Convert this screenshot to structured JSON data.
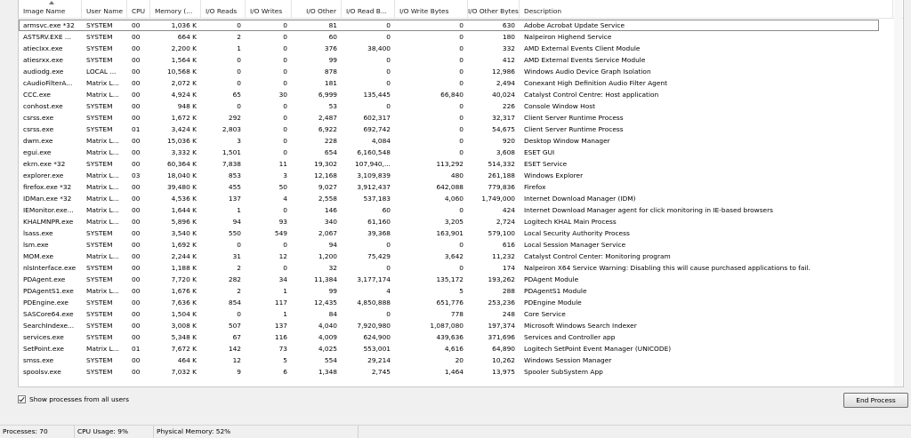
{
  "columns": [
    {
      "label": "Image Name",
      "align": "left"
    },
    {
      "label": "User Name",
      "align": "left"
    },
    {
      "label": "CPU",
      "align": "left"
    },
    {
      "label": "Memory (...",
      "align": "left"
    },
    {
      "label": "I/O Reads",
      "align": "left"
    },
    {
      "label": "I/O Writes",
      "align": "left"
    },
    {
      "label": "I/O Other",
      "align": "right"
    },
    {
      "label": "I/O Read B...",
      "align": "left"
    },
    {
      "label": "I/O Write Bytes",
      "align": "left"
    },
    {
      "label": "I/O Other Bytes",
      "align": "right"
    },
    {
      "label": "Description",
      "align": "left"
    }
  ],
  "rows": [
    [
      "armsvc.exe *32",
      "SYSTEM",
      "00",
      "1,036 K",
      "0",
      "0",
      "81",
      "0",
      "0",
      "630",
      "Adobe Acrobat Update Service"
    ],
    [
      "ASTSRV.EXE ...",
      "SYSTEM",
      "00",
      "664 K",
      "2",
      "0",
      "60",
      "0",
      "0",
      "180",
      "Nalpeiron Highend Service"
    ],
    [
      "atiecIxx.exe",
      "SYSTEM",
      "00",
      "2,200 K",
      "1",
      "0",
      "376",
      "38,400",
      "0",
      "332",
      "AMD External Events Client Module"
    ],
    [
      "atiesrxx.exe",
      "SYSTEM",
      "00",
      "1,564 K",
      "0",
      "0",
      "99",
      "0",
      "0",
      "412",
      "AMD External Events Service Module"
    ],
    [
      "audiodg.exe",
      "LOCAL ...",
      "00",
      "10,568 K",
      "0",
      "0",
      "878",
      "0",
      "0",
      "12,986",
      "Windows Audio Device Graph Isolation"
    ],
    [
      "cAudioFilterA...",
      "Matrix L...",
      "00",
      "2,072 K",
      "0",
      "0",
      "181",
      "0",
      "0",
      "2,494",
      "Conexant High Definition Audio Filter Agent"
    ],
    [
      "CCC.exe",
      "Matrix L...",
      "00",
      "4,924 K",
      "65",
      "30",
      "6,999",
      "135,445",
      "66,840",
      "40,024",
      "Catalyst Control Centre: Host application"
    ],
    [
      "conhost.exe",
      "SYSTEM",
      "00",
      "948 K",
      "0",
      "0",
      "53",
      "0",
      "0",
      "226",
      "Console Window Host"
    ],
    [
      "csrss.exe",
      "SYSTEM",
      "00",
      "1,672 K",
      "292",
      "0",
      "2,487",
      "602,317",
      "0",
      "32,317",
      "Client Server Runtime Process"
    ],
    [
      "csrss.exe",
      "SYSTEM",
      "01",
      "3,424 K",
      "2,803",
      "0",
      "6,922",
      "692,742",
      "0",
      "54,675",
      "Client Server Runtime Process"
    ],
    [
      "dwm.exe",
      "Matrix L...",
      "00",
      "15,036 K",
      "3",
      "0",
      "228",
      "4,084",
      "0",
      "920",
      "Desktop Window Manager"
    ],
    [
      "egui.exe",
      "Matrix L...",
      "00",
      "3,332 K",
      "1,501",
      "0",
      "654",
      "6,160,548",
      "0",
      "3,608",
      "ESET GUI"
    ],
    [
      "ekrn.exe *32",
      "SYSTEM",
      "00",
      "60,364 K",
      "7,838",
      "11",
      "19,302",
      "107,940,...",
      "113,292",
      "514,332",
      "ESET Service"
    ],
    [
      "explorer.exe",
      "Matrix L...",
      "03",
      "18,040 K",
      "853",
      "3",
      "12,168",
      "3,109,839",
      "480",
      "261,188",
      "Windows Explorer"
    ],
    [
      "firefox.exe *32",
      "Matrix L...",
      "00",
      "39,480 K",
      "455",
      "50",
      "9,027",
      "3,912,437",
      "642,088",
      "779,836",
      "Firefox"
    ],
    [
      "IDMan.exe *32",
      "Matrix L...",
      "00",
      "4,536 K",
      "137",
      "4",
      "2,558",
      "537,183",
      "4,060",
      "1,749,000",
      "Internet Download Manager (IDM)"
    ],
    [
      "IEMonitor.exe...",
      "Matrix L...",
      "00",
      "1,644 K",
      "1",
      "0",
      "146",
      "60",
      "0",
      "424",
      "Internet Download Manager agent for click monitoring in IE-based browsers"
    ],
    [
      "KHALMNPR.exe",
      "Matrix L...",
      "00",
      "5,896 K",
      "94",
      "93",
      "340",
      "61,160",
      "3,205",
      "2,724",
      "Logitech KHAL Main Process"
    ],
    [
      "lsass.exe",
      "SYSTEM",
      "00",
      "3,540 K",
      "550",
      "549",
      "2,067",
      "39,368",
      "163,901",
      "579,100",
      "Local Security Authority Process"
    ],
    [
      "lsm.exe",
      "SYSTEM",
      "00",
      "1,692 K",
      "0",
      "0",
      "94",
      "0",
      "0",
      "616",
      "Local Session Manager Service"
    ],
    [
      "MOM.exe",
      "Matrix L...",
      "00",
      "2,244 K",
      "31",
      "12",
      "1,200",
      "75,429",
      "3,642",
      "11,232",
      "Catalyst Control Center: Monitoring program"
    ],
    [
      "nlsInterface.exe",
      "SYSTEM",
      "00",
      "1,188 K",
      "2",
      "0",
      "32",
      "0",
      "0",
      "174",
      "Nalpeiron X64 Service  Warning:  Disabling this will cause purchased applications to fail."
    ],
    [
      "PDAgent.exe",
      "SYSTEM",
      "00",
      "7,720 K",
      "282",
      "34",
      "11,384",
      "3,177,174",
      "135,172",
      "193,262",
      "PDAgent Module"
    ],
    [
      "PDAgentS1.exe",
      "Matrix L...",
      "00",
      "1,676 K",
      "2",
      "1",
      "99",
      "4",
      "5",
      "288",
      "PDAgentS1 Module"
    ],
    [
      "PDEngine.exe",
      "SYSTEM",
      "00",
      "7,636 K",
      "854",
      "117",
      "12,435",
      "4,850,888",
      "651,776",
      "253,236",
      "PDEngine Module"
    ],
    [
      "SASCore64.exe",
      "SYSTEM",
      "00",
      "1,504 K",
      "0",
      "1",
      "84",
      "0",
      "778",
      "248",
      "Core Service"
    ],
    [
      "SearchIndexe...",
      "SYSTEM",
      "00",
      "3,008 K",
      "507",
      "137",
      "4,040",
      "7,920,980",
      "1,087,080",
      "197,374",
      "Microsoft Windows Search Indexer"
    ],
    [
      "services.exe",
      "SYSTEM",
      "00",
      "5,348 K",
      "67",
      "116",
      "4,009",
      "624,900",
      "439,636",
      "371,696",
      "Services and Controller app"
    ],
    [
      "SetPoint.exe",
      "Matrix L...",
      "01",
      "7,672 K",
      "142",
      "73",
      "4,025",
      "553,001",
      "4,616",
      "64,890",
      "Logitech SetPoint Event Manager (UNICODE)"
    ],
    [
      "smss.exe",
      "SYSTEM",
      "00",
      "464 K",
      "12",
      "5",
      "554",
      "29,214",
      "20",
      "10,262",
      "Windows Session Manager"
    ],
    [
      "spoolsv.exe",
      "SYSTEM",
      "00",
      "7,032 K",
      "9",
      "6",
      "1,348",
      "2,745",
      "1,464",
      "13,975",
      "Spooler SubSystem App"
    ]
  ],
  "show_all_label": "Show processes from all users",
  "show_all_checked": true,
  "end_process_label": "End Process",
  "status": {
    "processes": "Processes: 70",
    "cpu": "CPU Usage: 9%",
    "memory": "Physical Memory: 52%"
  }
}
